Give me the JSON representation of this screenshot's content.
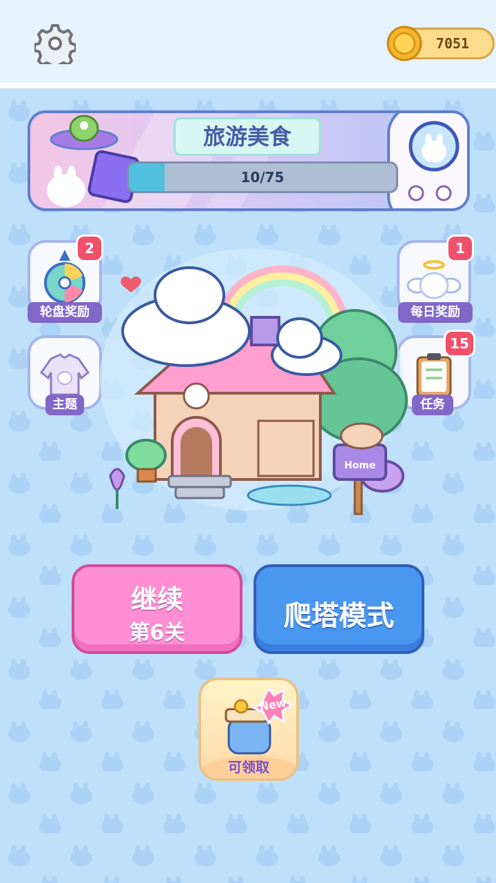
{
  "top_bar": {
    "settings_icon": "gear-icon",
    "coins": {
      "icon": "coin-icon",
      "value": "7051"
    }
  },
  "banner": {
    "title": "旅游美食",
    "progress_text": "10/75",
    "progress_fraction": 0.133
  },
  "side_buttons": {
    "wheel": {
      "label": "轮盘奖励",
      "badge": "2",
      "icon": "prize-wheel-icon"
    },
    "daily": {
      "label": "每日奖励",
      "badge": "1",
      "icon": "angel-bunny-icon"
    },
    "theme": {
      "label": "主题",
      "icon": "sweater-icon"
    },
    "tasks": {
      "label": "任务",
      "badge": "15",
      "icon": "clipboard-icon"
    }
  },
  "scene": {
    "sign_text": "Home"
  },
  "buttons": {
    "continue_label": "继续",
    "continue_level": "第6关",
    "tower_mode_label": "爬塔模式"
  },
  "gift": {
    "new_tag": "New",
    "label": "可领取",
    "icon": "gift-box-icon"
  },
  "colors": {
    "background": "#bfe0fb",
    "continue_button": "#ff8fd2",
    "tower_button": "#4a97f0",
    "label_purple": "#8067c8",
    "badge_red": "#f0506a"
  }
}
